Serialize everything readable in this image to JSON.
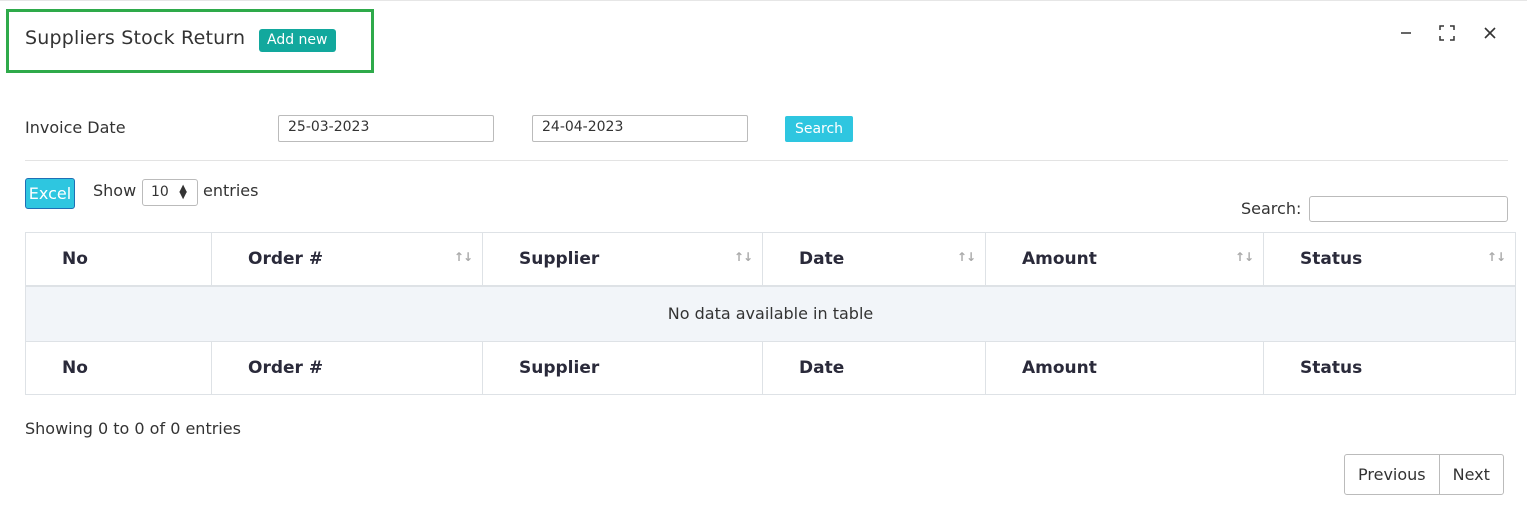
{
  "header": {
    "title": "Suppliers Stock Return",
    "add_new_label": "Add new",
    "highlight_color": "#2eaa4a"
  },
  "window_controls": {
    "minimize_icon": "minimize-icon",
    "maximize_icon": "maximize-icon",
    "close_icon": "close-icon"
  },
  "filter": {
    "label": "Invoice Date",
    "date_from": "25-03-2023",
    "date_to": "24-04-2023",
    "search_button": "Search"
  },
  "toolbar": {
    "excel_label": "Excel",
    "show_label": "Show",
    "page_length": "10",
    "entries_label": "entries",
    "search_label": "Search:",
    "search_value": ""
  },
  "table": {
    "columns": [
      "No",
      "Order #",
      "Supplier",
      "Date",
      "Amount",
      "Status"
    ],
    "empty_message": "No data available in table",
    "rows": []
  },
  "footer": {
    "info": "Showing 0 to 0 of 0 entries",
    "previous": "Previous",
    "next": "Next"
  },
  "colors": {
    "accent_teal": "#12a89d",
    "search_cyan": "#2ec6e0"
  }
}
